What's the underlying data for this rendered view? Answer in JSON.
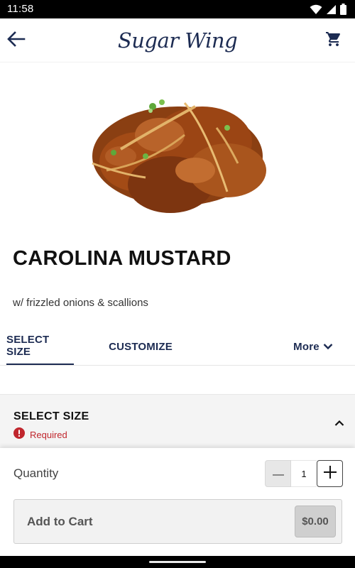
{
  "status_bar": {
    "time": "11:58",
    "icons": [
      "wifi-icon",
      "signal-icon",
      "battery-icon"
    ]
  },
  "header": {
    "brand": "Sugar Wing",
    "back_icon": "arrow-left-icon",
    "cart_icon": "shopping-cart-icon"
  },
  "product": {
    "title": "CAROLINA MUSTARD",
    "description": "w/ frizzled onions & scallions"
  },
  "tabs": {
    "select_size": "SELECT SIZE",
    "customize": "CUSTOMIZE",
    "more": "More",
    "active": "SELECT SIZE"
  },
  "section": {
    "title": "SELECT SIZE",
    "required": "Required"
  },
  "order": {
    "quantity_label": "Quantity",
    "quantity": "1",
    "add_to_cart": "Add to Cart",
    "price": "$0.00"
  },
  "colors": {
    "brand_navy": "#1c2b52",
    "required_red": "#c0262d",
    "panel_gray": "#f4f4f4"
  }
}
